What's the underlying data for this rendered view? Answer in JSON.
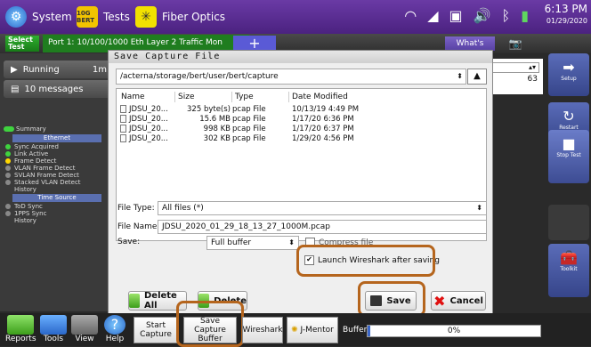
{
  "topbar": {
    "system_label": "System",
    "tests_label": "Tests",
    "tests_icon_text": "10G BERT",
    "fiber_label": "Fiber Optics",
    "time": "6:13 PM",
    "date": "01/29/2020"
  },
  "tabbar": {
    "select_test": "Select Test",
    "port_tab": "Port 1: 10/100/1000 Eth Layer 2 Traffic Mon",
    "add_tab": "+",
    "whats_this": "What's This?"
  },
  "left": {
    "running": "Running",
    "running_time": "1m",
    "messages": "10 messages",
    "summary": "Summary",
    "ethernet_header": "Ethernet",
    "items": [
      "Sync Acquired",
      "Link Active",
      "Frame Detect",
      "VLAN Frame Detect",
      "SVLAN Frame Detect",
      "Stacked VLAN Detect",
      "History"
    ],
    "time_source_header": "Time Source",
    "items2": [
      "ToD Sync",
      "1PPS Sync",
      "History"
    ]
  },
  "right": {
    "setup": "Setup",
    "restart": "Restart",
    "stop_test": "Stop Test",
    "toolkit": "Toolkit"
  },
  "background": {
    "value": "63"
  },
  "dialog": {
    "title": "Save Capture File",
    "path": "/acterna/storage/bert/user/bert/capture",
    "columns": [
      "Name",
      "Size",
      "Type",
      "Date Modified"
    ],
    "files": [
      {
        "name": "JDSU_20...",
        "size": "325 byte(s)",
        "type": "pcap File",
        "date": "10/13/19 4:49 PM"
      },
      {
        "name": "JDSU_20...",
        "size": "15.6 MB",
        "type": "pcap File",
        "date": "1/17/20 6:36 PM"
      },
      {
        "name": "JDSU_20...",
        "size": "998 KB",
        "type": "pcap File",
        "date": "1/17/20 6:37 PM"
      },
      {
        "name": "JDSU_20...",
        "size": "302 KB",
        "type": "pcap File",
        "date": "1/29/20 4:56 PM"
      }
    ],
    "file_type_label": "File Type:",
    "file_type_value": "All files (*)",
    "file_name_label": "File Name:",
    "file_name_value": "JDSU_2020_01_29_18_13_27_1000M.pcap",
    "save_label": "Save:",
    "save_value": "Full buffer",
    "compress_label": "Compress file",
    "launch_label": "Launch Wireshark after saving",
    "delete_all": "Delete All",
    "delete": "Delete",
    "save_button": "Save",
    "cancel_button": "Cancel"
  },
  "bottom": {
    "reports": "Reports",
    "tools": "Tools",
    "view": "View",
    "help": "Help",
    "start_capture": "Start Capture",
    "save_capture_buffer": "Save Capture Buffer",
    "wireshark": "Wireshark",
    "jmentor": "J-Mentor",
    "buffer_label": "Buffer",
    "buffer_value": "0%"
  }
}
